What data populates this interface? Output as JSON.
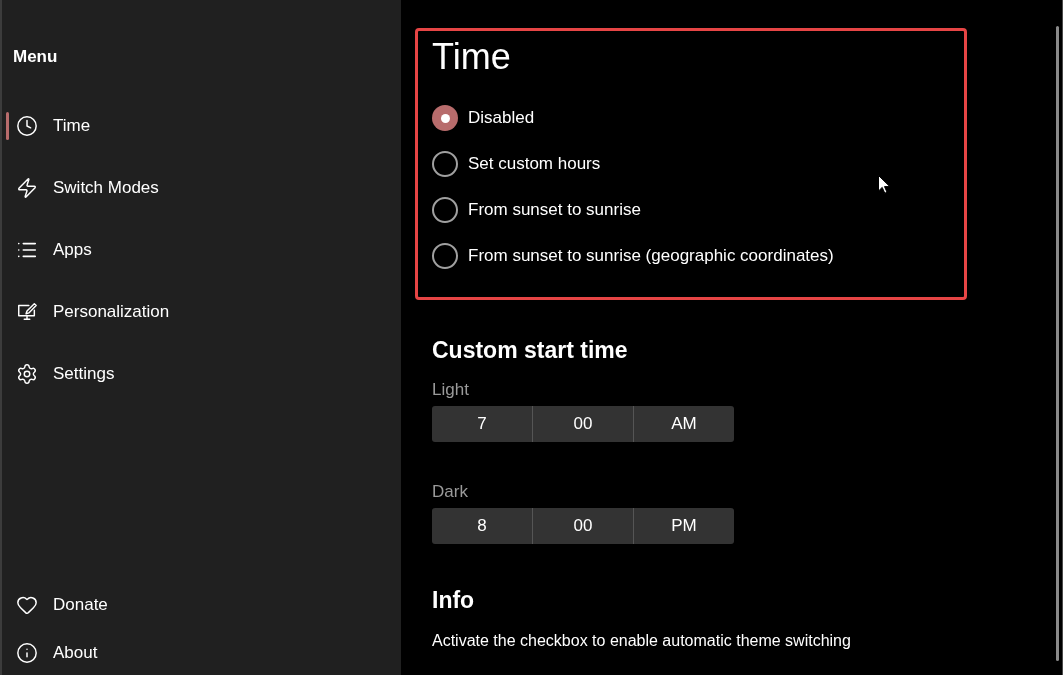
{
  "sidebar": {
    "title": "Menu",
    "items": [
      {
        "label": "Time",
        "selected": true
      },
      {
        "label": "Switch Modes",
        "selected": false
      },
      {
        "label": "Apps",
        "selected": false
      },
      {
        "label": "Personalization",
        "selected": false
      },
      {
        "label": "Settings",
        "selected": false
      }
    ],
    "footer_items": [
      {
        "label": "Donate",
        "selected": false
      },
      {
        "label": "About",
        "selected": false
      }
    ]
  },
  "time_mode": {
    "title": "Time",
    "options": [
      {
        "label": "Disabled",
        "selected": true
      },
      {
        "label": "Set custom hours",
        "selected": false
      },
      {
        "label": "From sunset to sunrise",
        "selected": false
      },
      {
        "label": "From sunset to sunrise (geographic coordinates)",
        "selected": false
      }
    ]
  },
  "custom_start_time": {
    "title": "Custom start time",
    "pickers": [
      {
        "label": "Light",
        "hour": "7",
        "minute": "00",
        "period": "AM"
      },
      {
        "label": "Dark",
        "hour": "8",
        "minute": "00",
        "period": "PM"
      }
    ]
  },
  "info": {
    "title": "Info",
    "text": "Activate the checkbox to enable automatic theme switching"
  }
}
